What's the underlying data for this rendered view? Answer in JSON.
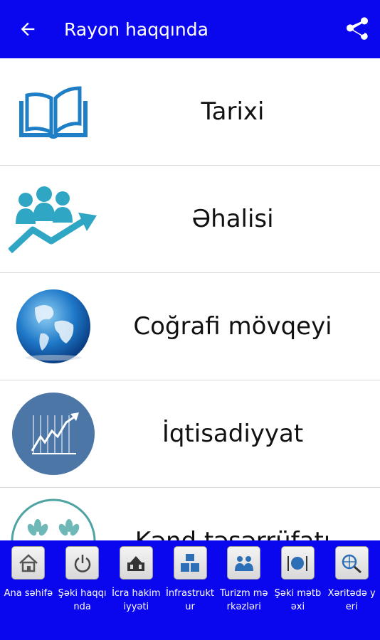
{
  "header": {
    "title": "Rayon haqqında",
    "back_icon": "arrow-left-icon",
    "share_icon": "share-icon",
    "background": "#0a06ee"
  },
  "items": [
    {
      "label": "Tarixi",
      "icon": "open-book-icon"
    },
    {
      "label": "Əhalisi",
      "icon": "population-growth-icon"
    },
    {
      "label": "Coğrafi mövqeyi",
      "icon": "globe-icon"
    },
    {
      "label": "İqtisadiyyat",
      "icon": "economy-chart-icon"
    },
    {
      "label": "Kənd təsərrüfatı",
      "icon": "wheat-icon"
    }
  ],
  "bottom_nav": [
    {
      "label": "Ana səhifə",
      "icon": "home-icon"
    },
    {
      "label": "Şəki haqqında",
      "icon": "power-icon"
    },
    {
      "label": "İcra hakimiyyəti",
      "icon": "government-building-icon"
    },
    {
      "label": "İnfrastruktur",
      "icon": "building-blocks-icon"
    },
    {
      "label": "Turizm mərkəzləri",
      "icon": "people-group-icon"
    },
    {
      "label": "Şəki mətbəxi",
      "icon": "plate-cutlery-icon"
    },
    {
      "label": "Xəritədə yeri",
      "icon": "globe-search-icon"
    }
  ]
}
